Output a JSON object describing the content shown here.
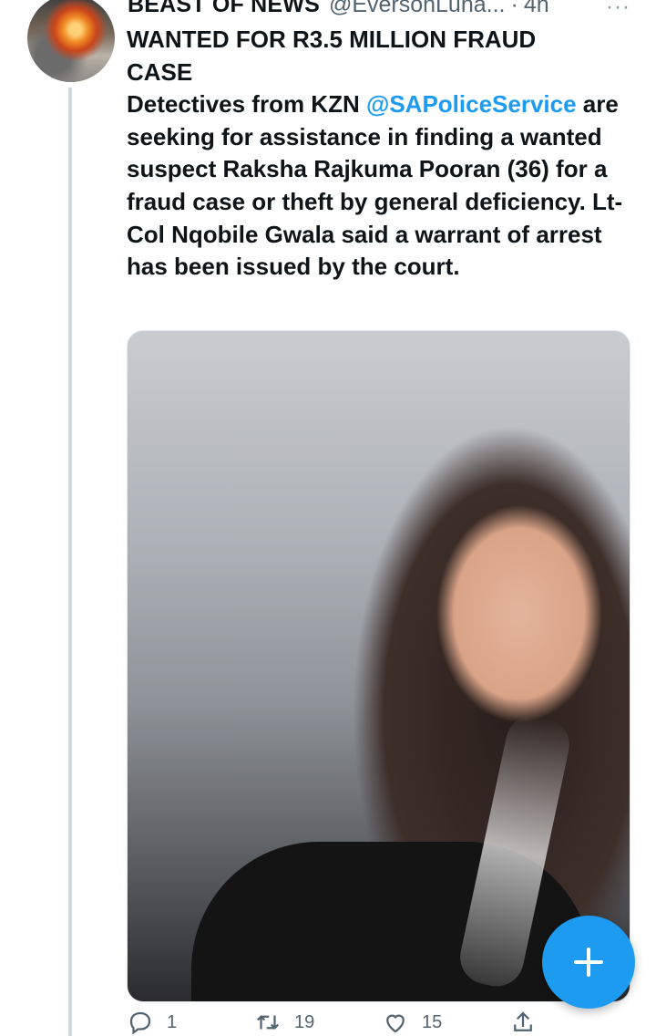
{
  "tweet": {
    "display_name": "BEAST OF NEWS",
    "handle": "@EversonLuha...",
    "separator": "·",
    "time": "4h",
    "more_label": "···",
    "headline_line1": "WANTED FOR R3.5 MILLION FRAUD",
    "headline_line2": "CASE",
    "body_prefix": "Detectives from KZN ",
    "mention": "@SAPoliceService",
    "body_rest": " are seeking for assistance in finding a wanted suspect Raksha Rajkuma Pooran (36) for a fraud case or theft by general deficiency. Lt-Col Nqobile Gwala said a warrant of arrest has been issued by the court.",
    "media_icon": "photo"
  },
  "actions": {
    "reply_count": "1",
    "retweet_count": "19",
    "like_count": "15",
    "reply_icon": "reply-icon",
    "retweet_icon": "retweet-icon",
    "like_icon": "heart-icon",
    "share_icon": "share-icon"
  },
  "fab": {
    "icon": "compose-plus-icon",
    "color": "#1d9bf0"
  },
  "colors": {
    "accent": "#1d9bf0",
    "text": "#0f1419",
    "secondary": "#536471",
    "thread_line": "#cfd9de"
  }
}
